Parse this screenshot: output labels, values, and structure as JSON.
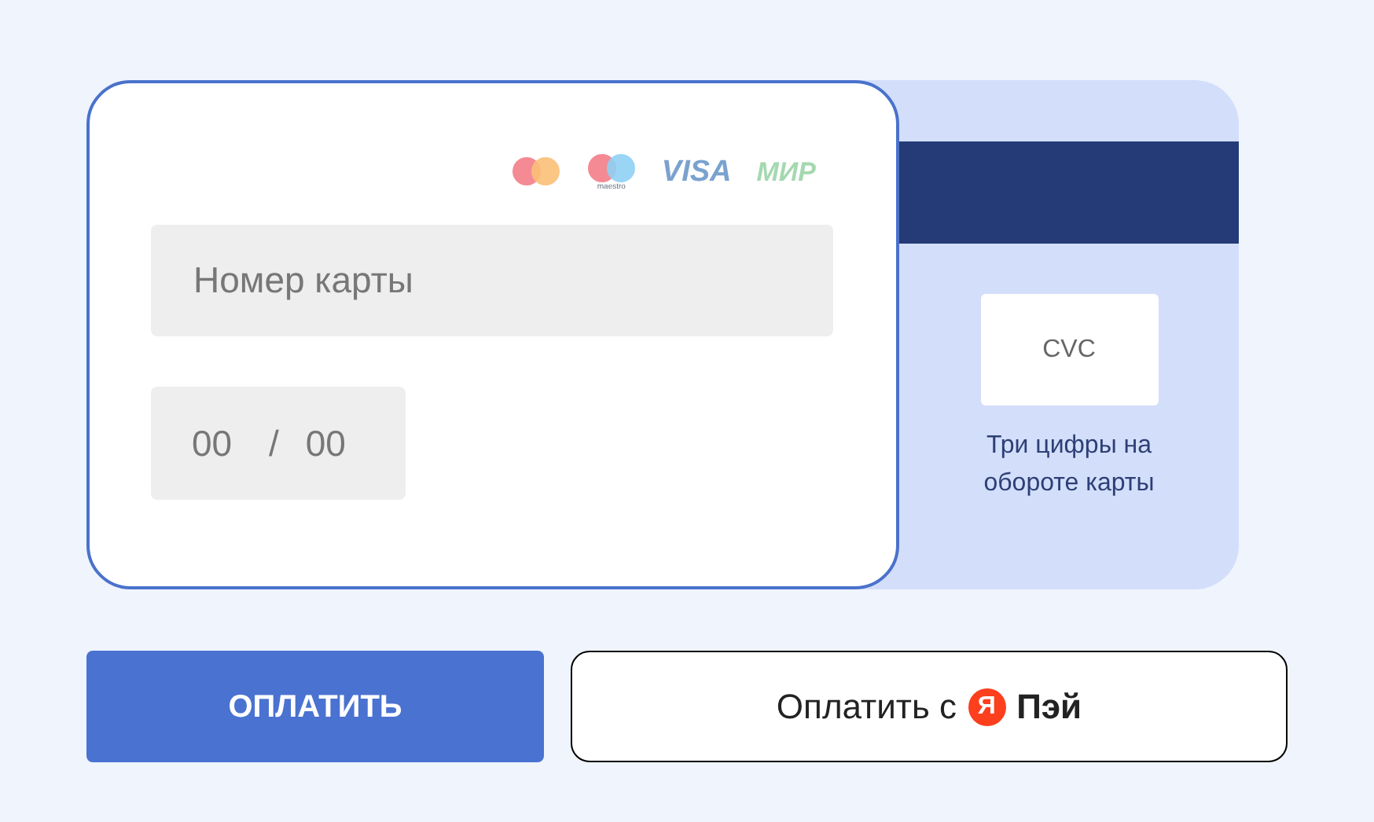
{
  "card_front": {
    "brands": [
      {
        "kind": "mastercard"
      },
      {
        "kind": "maestro",
        "caption": "maestro"
      },
      {
        "kind": "visa",
        "label": "VISA"
      },
      {
        "kind": "mir",
        "label": "МИР"
      }
    ],
    "card_number": {
      "placeholder": "Номер карты"
    },
    "expiry": {
      "month_placeholder": "00",
      "separator": "/",
      "year_placeholder": "00"
    }
  },
  "card_back": {
    "cvc": {
      "placeholder": "CVC"
    },
    "hint": "Три цифры на обороте карты"
  },
  "buttons": {
    "pay": "ОПЛАТИТЬ",
    "yandex_pay": {
      "label": "Оплатить с",
      "logo_letter": "Я",
      "brand": "Пэй"
    }
  }
}
